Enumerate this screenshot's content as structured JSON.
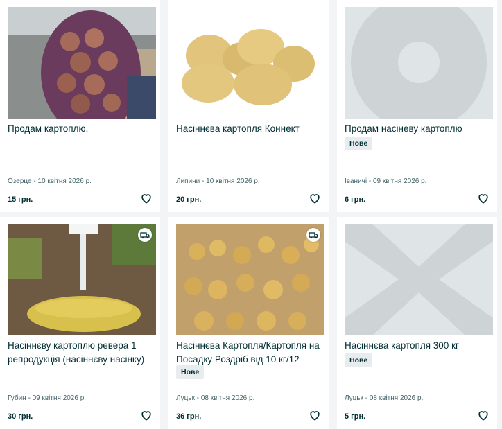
{
  "listings": [
    {
      "title": "Продам картоплю.",
      "badge": "",
      "location_date": "Озерце - 10 квітня 2026 р.",
      "price": "15 грн.",
      "delivery": false
    },
    {
      "title": "Насіннєва картопля Коннект",
      "badge": "",
      "location_date": "Липини - 10 квітня 2026 р.",
      "price": "20 грн.",
      "delivery": false
    },
    {
      "title": "Продам насіневу картоплю",
      "badge": "Нове",
      "location_date": "Іваничі - 09 квітня 2026 р.",
      "price": "6 грн.",
      "delivery": false
    },
    {
      "title": "Насіннєву картоплю ревера 1 репродукція (насіннєву насінку)",
      "badge": "",
      "location_date": "Губин - 09 квітня 2026 р.",
      "price": "30 грн.",
      "delivery": true
    },
    {
      "title": "Насіннєва Картопля/Картопля на Посадку Роздріб від 10 кг/12 сортів",
      "badge": "Нове",
      "location_date": "Луцьк - 08 квітня 2026 р.",
      "price": "36 грн.",
      "delivery": true
    },
    {
      "title": "Насіннєва картопля 300 кг",
      "badge": "Нове",
      "location_date": "Луцьк - 08 квітня 2026 р.",
      "price": "5 грн.",
      "delivery": false
    }
  ],
  "icons": {
    "favorite": "heart-icon",
    "delivery": "delivery-truck-icon",
    "placeholder": "image-placeholder-icon"
  },
  "colors": {
    "text": "#002f34",
    "muted": "#406367",
    "badge_bg": "#e8ecee",
    "placeholder": "#dfe4e6",
    "background": "#f2f4f5"
  }
}
